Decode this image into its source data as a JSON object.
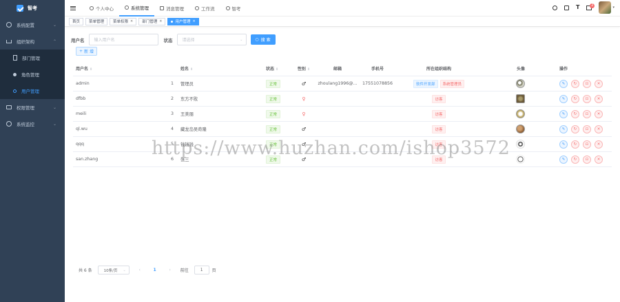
{
  "app": {
    "title": "智考"
  },
  "sidebar": {
    "items": [
      {
        "label": "系统配置",
        "icon": "gear-icon"
      },
      {
        "label": "组织架构",
        "icon": "org-tree-icon"
      },
      {
        "label": "部门管理",
        "icon": "doc-icon"
      },
      {
        "label": "角色管理",
        "icon": "user-icon"
      },
      {
        "label": "用户管理",
        "icon": "user-outline-icon"
      },
      {
        "label": "权限管理",
        "icon": "lock-icon"
      },
      {
        "label": "系统监控",
        "icon": "monitor-icon"
      }
    ]
  },
  "topnav": {
    "tabs": [
      {
        "label": "个人中心"
      },
      {
        "label": "系统管理"
      },
      {
        "label": "消息管理"
      },
      {
        "label": "工作流"
      },
      {
        "label": "智考"
      }
    ],
    "badge": "2"
  },
  "tags": [
    {
      "label": "首页"
    },
    {
      "label": "菜单管理"
    },
    {
      "label": "菜单权限"
    },
    {
      "label": "部门管理"
    },
    {
      "label": "用户管理"
    }
  ],
  "search": {
    "username_label": "用户名",
    "username_placeholder": "输入用户名",
    "status_label": "状态",
    "status_placeholder": "请选择",
    "search_button": "搜 索",
    "add_button": "新 增"
  },
  "table": {
    "headers": {
      "username": "用户名",
      "nickname": "姓名",
      "status": "状态",
      "sex": "性别",
      "email": "邮箱",
      "phone": "手机号",
      "org": "所在组织结构",
      "avatar": "头像",
      "ops": "操作"
    },
    "rows": [
      {
        "username": "admin",
        "idx": "1",
        "nickname": "管理员",
        "status": "正常",
        "sex": "♂",
        "email": "zhoulang1996@...",
        "phone": "17551078856",
        "org": "软件开发部",
        "role": "系统管理员"
      },
      {
        "username": "dfbb",
        "idx": "2",
        "nickname": "东方不败",
        "status": "正常",
        "sex": "♀",
        "email": "",
        "phone": "",
        "org": "",
        "role": "访客"
      },
      {
        "username": "meili",
        "idx": "3",
        "nickname": "王美丽",
        "status": "正常",
        "sex": "♀",
        "email": "",
        "phone": "",
        "org": "",
        "role": "访客"
      },
      {
        "username": "ql.wu",
        "idx": "4",
        "nickname": "藏龙岛吴奇隆",
        "status": "正常",
        "sex": "♂",
        "email": "",
        "phone": "",
        "org": "",
        "role": "访客"
      },
      {
        "username": "qqq",
        "idx": "5",
        "nickname": "钱钱钱",
        "status": "正常",
        "sex": "♂",
        "email": "",
        "phone": "",
        "org": "",
        "role": "访客"
      },
      {
        "username": "san.zhang",
        "idx": "6",
        "nickname": "张三",
        "status": "正常",
        "sex": "♂",
        "email": "",
        "phone": "",
        "org": "",
        "role": "访客"
      }
    ]
  },
  "pager": {
    "total": "共 6 条",
    "page_size": "10条/页",
    "prev": "‹",
    "current": "1",
    "next": "›",
    "goto_label": "前往",
    "goto_value": "1",
    "page_suffix": "页"
  },
  "watermark": "https://www.huzhan.com/ishop3572",
  "colors": {
    "sidebar": "#304156",
    "accent": "#409eff",
    "danger": "#f56c6c",
    "success": "#67c23a"
  }
}
